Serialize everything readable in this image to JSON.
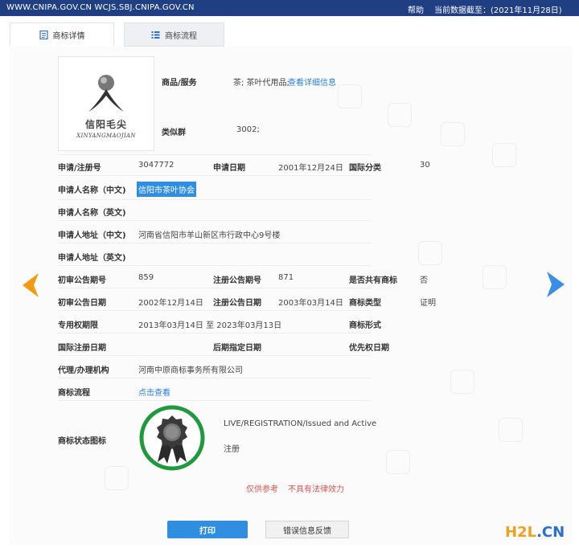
{
  "topbar": {
    "url": "WWW.CNIPA.GOV.CN WCJS.SBJ.CNIPA.GOV.CN",
    "help": "帮助",
    "date": "当前数据截至：(2021年11月28日)"
  },
  "tabs": [
    {
      "label": "商标详情",
      "icon": "document-icon"
    },
    {
      "label": "商标流程",
      "icon": "list-icon"
    }
  ],
  "logo": {
    "cn": "信阳毛尖",
    "pinyin": "XINYANGMAOJIAN"
  },
  "fields": {
    "goods_label": "商品/服务",
    "goods_value": "茶; 茶叶代用品;",
    "goods_link": "查看详细信息",
    "similar_label": "类似群",
    "similar_value": "3002;",
    "reg_no_label": "申请/注册号",
    "reg_no_value": "3047772",
    "apply_date_label": "申请日期",
    "apply_date_value": "2001年12月24日",
    "intl_class_label": "国际分类",
    "intl_class_value": "30",
    "applicant_cn_label": "申请人名称（中文)",
    "applicant_cn_value": "信阳市茶叶协会",
    "applicant_en_label": "申请人名称（英文)",
    "address_cn_label": "申请人地址（中文)",
    "address_cn_value": "河南省信阳市羊山新区市行政中心9号楼",
    "address_en_label": "申请人地址（英文)",
    "prelim_no_label": "初审公告期号",
    "prelim_no_value": "859",
    "reg_pub_no_label": "注册公告期号",
    "reg_pub_no_value": "871",
    "shared_label": "是否共有商标",
    "shared_value": "否",
    "prelim_date_label": "初审公告日期",
    "prelim_date_value": "2002年12月14日",
    "reg_pub_date_label": "注册公告日期",
    "reg_pub_date_value": "2003年03月14日",
    "tm_type_label": "商标类型",
    "tm_type_value": "证明",
    "excl_period_label": "专用权期限",
    "excl_period_value": "2013年03月14日 至 2023年03月13日",
    "tm_form_label": "商标形式",
    "intl_reg_date_label": "国际注册日期",
    "later_date_label": "后期指定日期",
    "priority_date_label": "优先权日期",
    "agent_label": "代理/办理机构",
    "agent_value": "河南中原商标事务所有限公司",
    "flow_label": "商标流程",
    "flow_link": "点击查看",
    "status_icon_label": "商标状态图标",
    "status_en": "LIVE/REGISTRATION/Issued and Active",
    "status_cn": "注册"
  },
  "notice": {
    "part1": "仅供参考",
    "part2": "不具有法律效力"
  },
  "buttons": {
    "print": "打印",
    "feedback": "错误信息反馈"
  },
  "watermark": {
    "part1": "H2L",
    "part2": ".CN"
  },
  "colors": {
    "topbar": "#1f3f82",
    "accent": "#2f8ee0",
    "arrow_left": "#f39c12",
    "arrow_right": "#3a8ee6",
    "badge_ring": "#1e9a3c",
    "notice": "#d9534f"
  }
}
